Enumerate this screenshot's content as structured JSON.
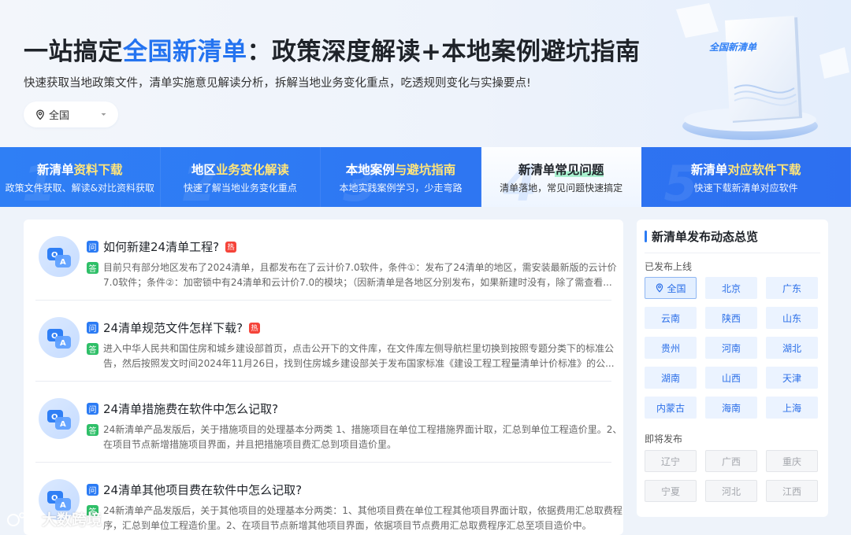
{
  "hero": {
    "title_pre": "一站搞定",
    "title_highlight": "全国新清单",
    "title_post": "：政策深度解读+本地案例避坑指南",
    "subtitle": "快速获取当地政策文件，清单实施意见解读分析，拆解当地业务变化重点，吃透规则变化与实操要点!",
    "region_select": {
      "value": "全国",
      "icon": "location-pin-icon"
    },
    "book_cover_text": "全国新清单"
  },
  "nav": [
    {
      "num": "1",
      "title_a": "新清单",
      "title_b": "资料下载",
      "sub": "政策文件获取、解读&对比资料获取",
      "active": false
    },
    {
      "num": "2",
      "title_a": "地区",
      "title_b": "业务变化解读",
      "sub": "快速了解当地业务变化重点",
      "active": false
    },
    {
      "num": "3",
      "title_a": "本地案例",
      "title_b": "与避坑指南",
      "sub": "本地实践案例学习，少走弯路",
      "active": false
    },
    {
      "num": "4",
      "title_a": "新清单",
      "title_b": "常见问题",
      "sub": "清单落地，常见问题快速搞定",
      "active": true
    },
    {
      "num": "5",
      "title_a": "新清单",
      "title_b": "对应软件下载",
      "sub": "快速下载新清单对应软件",
      "active": false
    }
  ],
  "qa": {
    "q_tag": "问",
    "a_tag": "答",
    "hot_tag": "热",
    "items": [
      {
        "question": "如何新建24清单工程?",
        "hot": true,
        "answer": "目前只有部分地区发布了2024清单，且都发布在了云计价7.0软件，条件①：发布了24清单的地区，需安装最新版的云计价7.0软件；条件②：加密锁中有24清单和云计价7.0的模块；（因新清单是各地区分别发布，如果新建时没有，除了需查看..."
      },
      {
        "question": "24清单规范文件怎样下载?",
        "hot": true,
        "answer": "进入中华人民共和国住房和城乡建设部首页，点击公开下的文件库，在文件库左侧导航栏里切换到按照专题分类下的标准公告，然后按照发文时间2024年11月26日，找到住房城乡建设部关于发布国家标准《建设工程工程量清单计价标准》的公..."
      },
      {
        "question": "24清单措施费在软件中怎么记取?",
        "hot": false,
        "answer": "24新清单产品发版后，关于措施项目的处理基本分两类 1、措施项目在单位工程措施界面计取，汇总到单位工程造价里。2、在项目节点新增措施项目界面，并且把措施项目费汇总到项目造价里。"
      },
      {
        "question": "24清单其他项目费在软件中怎么记取?",
        "hot": false,
        "answer": "24新清单产品发版后，关于其他项目的处理基本分两类：1、其他项目费在单位工程其他项目界面计取，依据费用汇总取费程序，汇总到单位工程造价里。2、在项目节点新增其他项目界面，依据项目节点费用汇总取费程序汇总至项目造价中。"
      }
    ]
  },
  "sidebar": {
    "title": "新清单发布动态总览",
    "published_label": "已发布上线",
    "published": [
      "全国",
      "北京",
      "广东",
      "云南",
      "陕西",
      "山东",
      "贵州",
      "河南",
      "湖北",
      "湖南",
      "山西",
      "天津",
      "内蒙古",
      "海南",
      "上海"
    ],
    "upcoming_label": "即将发布",
    "upcoming": [
      "辽宁",
      "广西",
      "重庆",
      "宁夏",
      "河北",
      "江西"
    ]
  },
  "watermark": {
    "text": "大数跨境",
    "icon": "paw-logo-icon"
  },
  "colors": {
    "brand_blue": "#2473f0",
    "nav_blue": "#2f7ff5",
    "answer_green": "#2fbf68",
    "hot_red": "#f5443a"
  }
}
